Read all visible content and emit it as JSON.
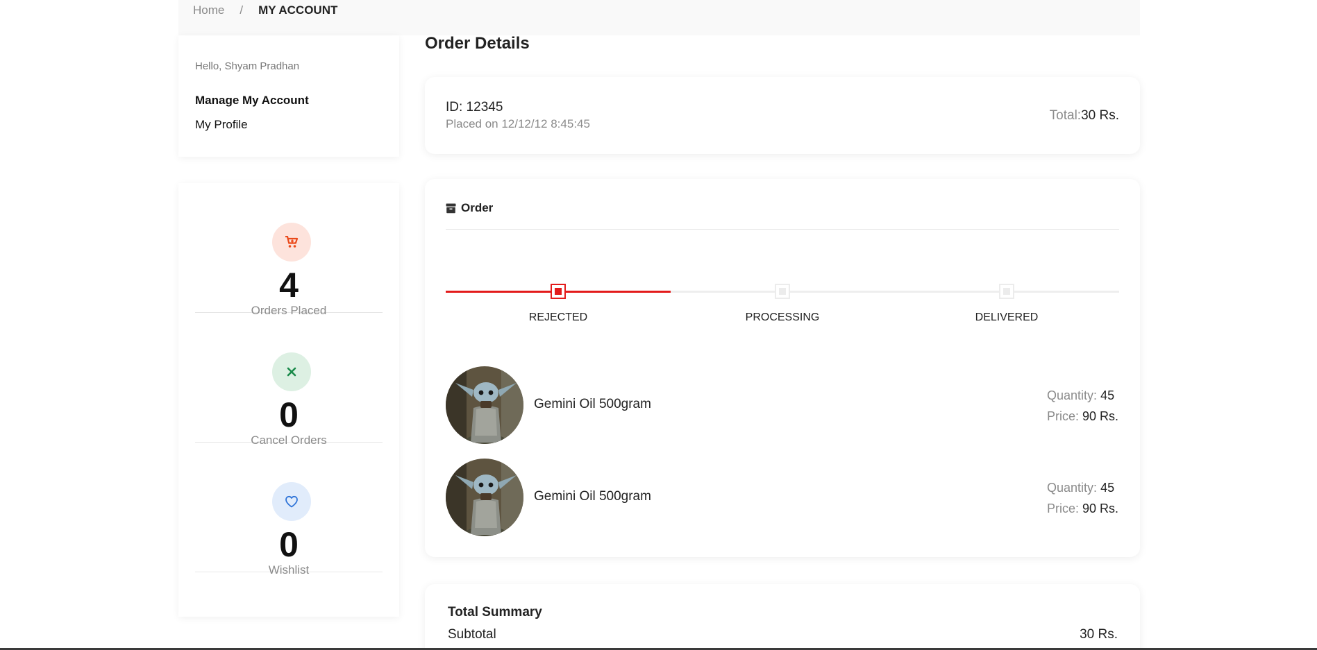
{
  "breadcrumb": {
    "home": "Home",
    "separator": "/",
    "current": "MY ACCOUNT"
  },
  "account": {
    "greeting": "Hello, Shyam Pradhan",
    "links": [
      "Manage My Account",
      "My Profile"
    ]
  },
  "stats": [
    {
      "icon": "cart-icon",
      "value": "4",
      "label": "Orders Placed",
      "color": "#ea4a1b",
      "bg": "#fde3dc"
    },
    {
      "icon": "x-icon",
      "value": "0",
      "label": "Cancel Orders",
      "color": "#1a8a4a",
      "bg": "#ddf0e3"
    },
    {
      "icon": "heart-icon",
      "value": "0",
      "label": "Wishlist",
      "color": "#2f74d8",
      "bg": "#e1ecfb"
    }
  ],
  "page_title": "Order Details",
  "order": {
    "id": "ID: 12345",
    "placed": "Placed on 12/12/12 8:45:45",
    "total_label": "Total:",
    "total_value": "30 Rs.",
    "section_title": "Order",
    "steps": [
      {
        "label": "REJECTED",
        "state": "active"
      },
      {
        "label": "PROCESSING",
        "state": "idle"
      },
      {
        "label": "DELIVERED",
        "state": "idle"
      }
    ],
    "progress_color": "#e31b1b",
    "items": [
      {
        "name": "Gemini Oil 500gram",
        "qty_label": "Quantity:",
        "qty": "45",
        "price_label": "Price:",
        "price": "90 Rs."
      },
      {
        "name": "Gemini Oil 500gram",
        "qty_label": "Quantity:",
        "qty": "45",
        "price_label": "Price:",
        "price": "90 Rs."
      }
    ]
  },
  "summary": {
    "title": "Total Summary",
    "subtotal_label": "Subtotal",
    "subtotal_value": "30 Rs."
  }
}
